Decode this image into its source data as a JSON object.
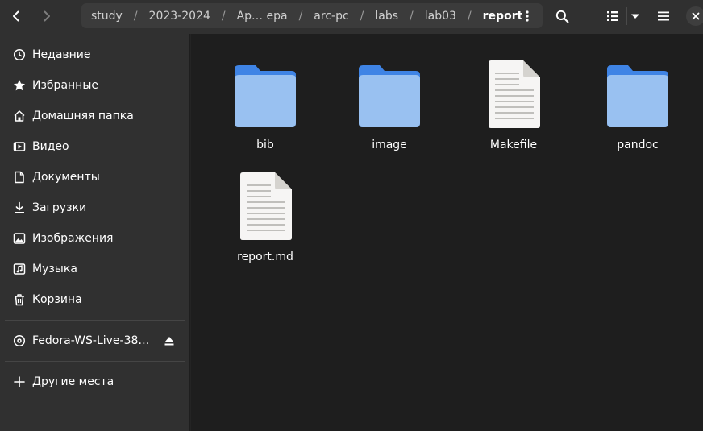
{
  "header": {
    "path": [
      "study",
      "2023-2024",
      "Ар… ера",
      "arc-pc",
      "labs",
      "lab03",
      "report"
    ],
    "path_separator": "/",
    "accent_color": "#ffffff"
  },
  "sidebar": {
    "items": [
      {
        "label": "Недавние",
        "icon": "clock-icon"
      },
      {
        "label": "Избранные",
        "icon": "star-icon"
      },
      {
        "label": "Домашняя папка",
        "icon": "home-icon"
      },
      {
        "label": "Видео",
        "icon": "video-icon"
      },
      {
        "label": "Документы",
        "icon": "document-icon"
      },
      {
        "label": "Загрузки",
        "icon": "download-icon"
      },
      {
        "label": "Изображения",
        "icon": "image-icon"
      },
      {
        "label": "Музыка",
        "icon": "music-icon"
      },
      {
        "label": "Корзина",
        "icon": "trash-icon"
      }
    ],
    "device": {
      "label": "Fedora-WS-Live-38…",
      "icon": "disc-icon"
    },
    "other_places": {
      "label": "Другие места",
      "icon": "plus-icon"
    }
  },
  "files": [
    {
      "name": "bib",
      "type": "folder"
    },
    {
      "name": "image",
      "type": "folder"
    },
    {
      "name": "Makefile",
      "type": "file"
    },
    {
      "name": "pandoc",
      "type": "folder"
    },
    {
      "name": "report.md",
      "type": "file"
    }
  ],
  "colors": {
    "folder_back": "#3f84e5",
    "folder_front": "#99c1f1",
    "file_page": "#f6f5f4",
    "file_lines": "#c0bfbc"
  }
}
